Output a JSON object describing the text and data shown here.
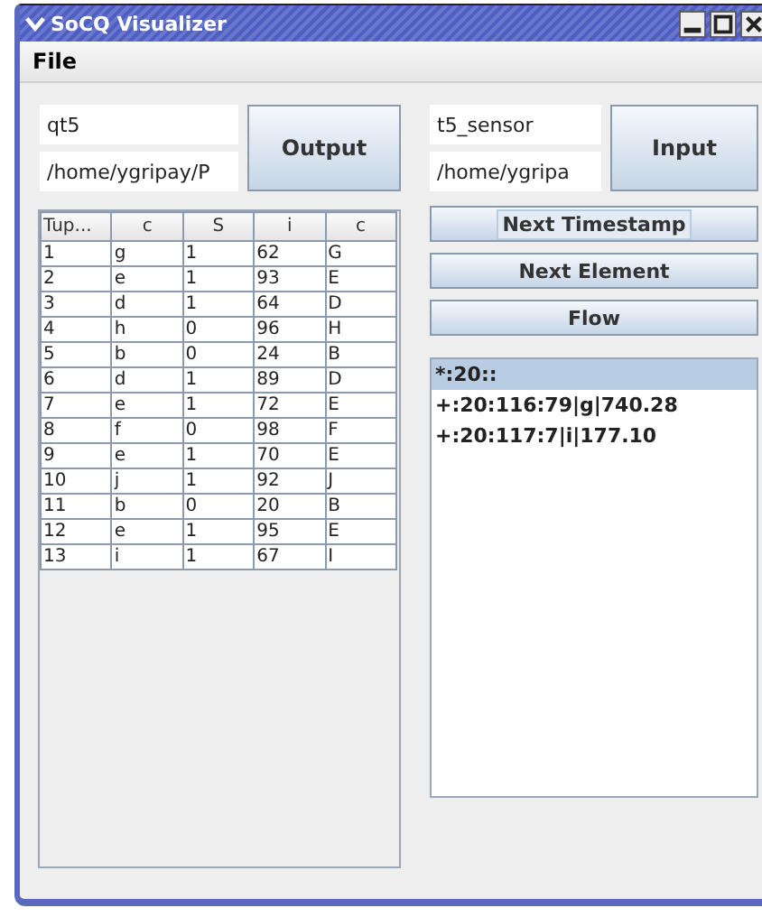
{
  "window": {
    "title": "SoCQ Visualizer"
  },
  "menu": [
    "File"
  ],
  "output": {
    "name": "qt5",
    "path": "/home/ygripay/P",
    "button": "Output"
  },
  "input": {
    "name": "t5_sensor",
    "path": "/home/ygripa",
    "button": "Input"
  },
  "table": {
    "columns": [
      "Tup...",
      "c",
      "S",
      "i",
      "c"
    ],
    "rows": [
      [
        "1",
        "g",
        "1",
        "62",
        "G"
      ],
      [
        "2",
        "e",
        "1",
        "93",
        "E"
      ],
      [
        "3",
        "d",
        "1",
        "64",
        "D"
      ],
      [
        "4",
        "h",
        "0",
        "96",
        "H"
      ],
      [
        "5",
        "b",
        "0",
        "24",
        "B"
      ],
      [
        "6",
        "d",
        "1",
        "89",
        "D"
      ],
      [
        "7",
        "e",
        "1",
        "72",
        "E"
      ],
      [
        "8",
        "f",
        "0",
        "98",
        "F"
      ],
      [
        "9",
        "e",
        "1",
        "70",
        "E"
      ],
      [
        "10",
        "j",
        "1",
        "92",
        "J"
      ],
      [
        "11",
        "b",
        "0",
        "20",
        "B"
      ],
      [
        "12",
        "e",
        "1",
        "95",
        "E"
      ],
      [
        "13",
        "i",
        "1",
        "67",
        "I"
      ]
    ]
  },
  "actions": [
    {
      "label": "Next Timestamp",
      "focused": true
    },
    {
      "label": "Next Element",
      "focused": false
    },
    {
      "label": "Flow",
      "focused": false
    }
  ],
  "stream": [
    {
      "text": "*:20::",
      "selected": true
    },
    {
      "text": "+:20:116:79|g|740.28",
      "selected": false
    },
    {
      "text": "+:20:117:7|i|177.10",
      "selected": false
    }
  ]
}
